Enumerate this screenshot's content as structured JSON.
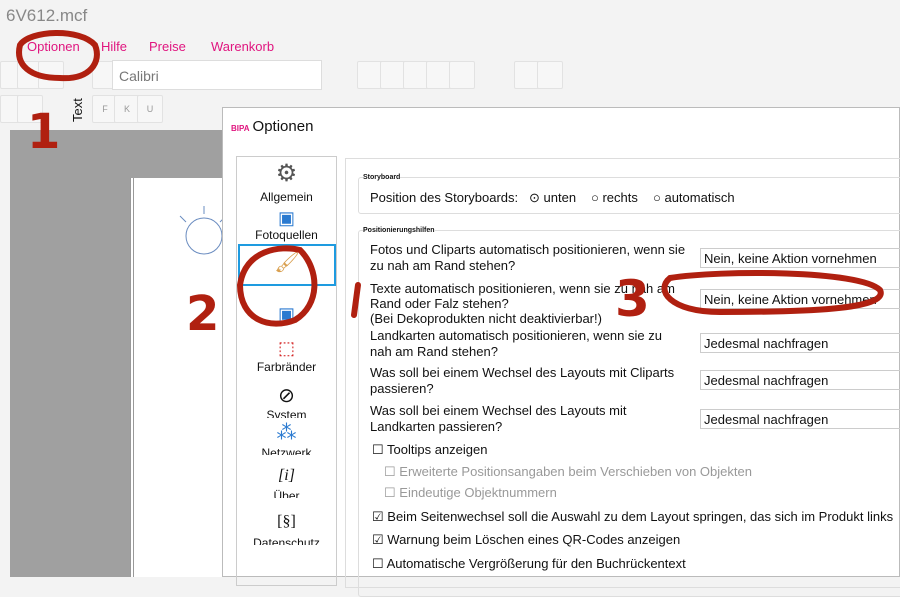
{
  "window": {
    "title": "6V612.mcf"
  },
  "menu": [
    "Optionen",
    "Hilfe",
    "Preise",
    "Warenkorb"
  ],
  "toolbar": {
    "font": "Calibri",
    "text_tab": "Text",
    "bold": "F",
    "italic": "K",
    "underline": "U"
  },
  "dialog": {
    "brand": "BIPA",
    "title": "Optionen",
    "sidebar": [
      {
        "label": "Allgemein",
        "icon": "gear-icon"
      },
      {
        "label": "Fotoquellen",
        "icon": "image-icon"
      },
      {
        "label": "",
        "icon": "brush-icon",
        "selected": true
      },
      {
        "label": "",
        "icon": "image-icon"
      },
      {
        "label": "Farbränder",
        "icon": "frame-icon"
      },
      {
        "label": "System",
        "icon": "system-icon"
      },
      {
        "label": "Netzwerk",
        "icon": "network-icon"
      },
      {
        "label": "Über",
        "icon": "info-icon"
      },
      {
        "label": "Datenschutz",
        "icon": "paragraph-icon"
      }
    ],
    "storyboard": {
      "legend": "Storyboard",
      "label": "Position des Storyboards:",
      "options": [
        "unten",
        "rechts",
        "automatisch"
      ],
      "selected": "unten"
    },
    "positioning": {
      "legend": "Positionierungshilfen",
      "rows": [
        {
          "q1": "Fotos und Cliparts automatisch positionieren, wenn sie",
          "q2": "zu nah am Rand stehen?",
          "q3": "",
          "value": "Nein, keine Aktion vornehmen"
        },
        {
          "q1": "Texte automatisch positionieren, wenn sie zu nah am",
          "q2": "Rand oder Falz stehen?",
          "q3": "(Bei Dekoprodukten nicht deaktivierbar!)",
          "value": "Nein, keine Aktion vornehmen"
        },
        {
          "q1": "Landkarten automatisch positionieren, wenn sie zu",
          "q2": "nah am Rand stehen?",
          "q3": "",
          "value": "Jedesmal nachfragen"
        },
        {
          "q1": "Was soll bei einem Wechsel des Layouts mit Cliparts",
          "q2": "passieren?",
          "q3": "",
          "value": "Jedesmal nachfragen"
        },
        {
          "q1": "Was soll bei einem Wechsel des Layouts mit",
          "q2": "Landkarten passieren?",
          "q3": "",
          "value": "Jedesmal nachfragen"
        }
      ]
    },
    "checkboxes": [
      {
        "label": "Tooltips anzeigen",
        "checked": false
      },
      {
        "label": "Erweiterte Positionsangaben beim Verschieben von Objekten",
        "checked": false,
        "disabled": true
      },
      {
        "label": "Eindeutige Objektnummern",
        "checked": false,
        "disabled": true
      },
      {
        "label": "Beim Seitenwechsel soll die Auswahl zu dem Layout springen, das sich im Produkt links",
        "checked": true
      },
      {
        "label": "Warnung beim Löschen eines QR-Codes anzeigen",
        "checked": true
      },
      {
        "label": "Automatische Vergrößerung für den Buchrückentext",
        "checked": false
      }
    ]
  },
  "annotations": {
    "step1": "1",
    "step2": "2",
    "step3": "3",
    "color": "#b02010"
  }
}
